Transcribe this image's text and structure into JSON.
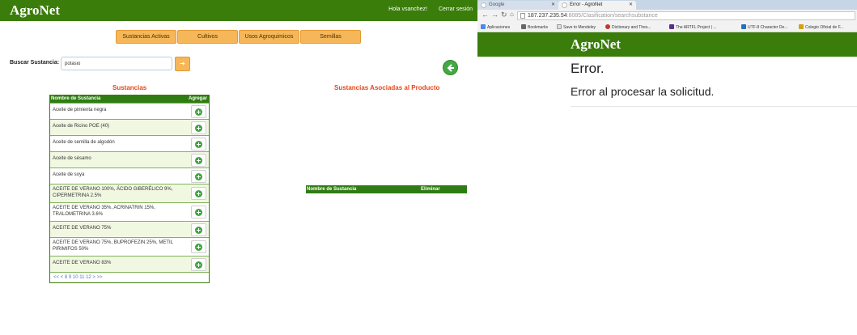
{
  "left_app": {
    "brand": "AgroNet",
    "greeting": "Hola vsanchez!",
    "logout": "Cerrar sesión",
    "nav": [
      "Sustancias Activas",
      "Cultivos",
      "Usos Agroquimicos",
      "Semillas"
    ],
    "search": {
      "label": "Buscar Sustancia:",
      "value": "potasio",
      "button_icon": "search-icon"
    },
    "back_icon": "arrow-left-icon",
    "sustancias": {
      "title": "Sustancias",
      "columns": [
        "Nombre de Sustancia",
        "Agregar"
      ],
      "rows": [
        "Aceite de pimienta negra",
        "Aceite de Ricino POE (40)",
        "Aceite de semilla de algodón",
        "Aceite de sésamo",
        "Aceite de soya",
        "ACEITE DE VERANO 100%, ÁCIDO GIBERÉLICO 9%, CIPERMETRINA 2.5%",
        "ACEITE DE VERANO 35%, ACRINATRIN 15%, TRALOMETRINA 3.6%",
        "ACEITE DE VERANO 75%",
        "ACEITE DE VERANO 75%, BUPROFEZIN 25%, METIL PIRIMIFOS 50%",
        "ACEITE DE VERANO 83%"
      ],
      "pager": "<< < 8 9 10 11 12 > >>"
    },
    "asociadas": {
      "title": "Sustancias Asociadas al Producto",
      "columns": [
        "Nombre de Sustancia",
        "Eliminar"
      ]
    },
    "colors": {
      "header_green": "#3a7d0a",
      "nav_orange": "#f5b759",
      "title_red": "#e8461a"
    }
  },
  "browser": {
    "tabs": [
      {
        "label": "Google",
        "active": false
      },
      {
        "label": "Error - AgroNet",
        "active": true
      }
    ],
    "url_host": "187.237.235.54",
    "url_rest": ":8085/Clasification/searchsubstance",
    "bookmarks": [
      "Aplicaciones",
      "Bookmarks",
      "Save to Mendeley",
      "Dictionary and Thes...",
      "The ARTFL Project | ...",
      "UTF-8 Character De...",
      "Colegio Oficial de F..."
    ],
    "page": {
      "brand": "AgroNet",
      "error_title": "Error.",
      "error_message": "Error al procesar la solicitud."
    }
  }
}
